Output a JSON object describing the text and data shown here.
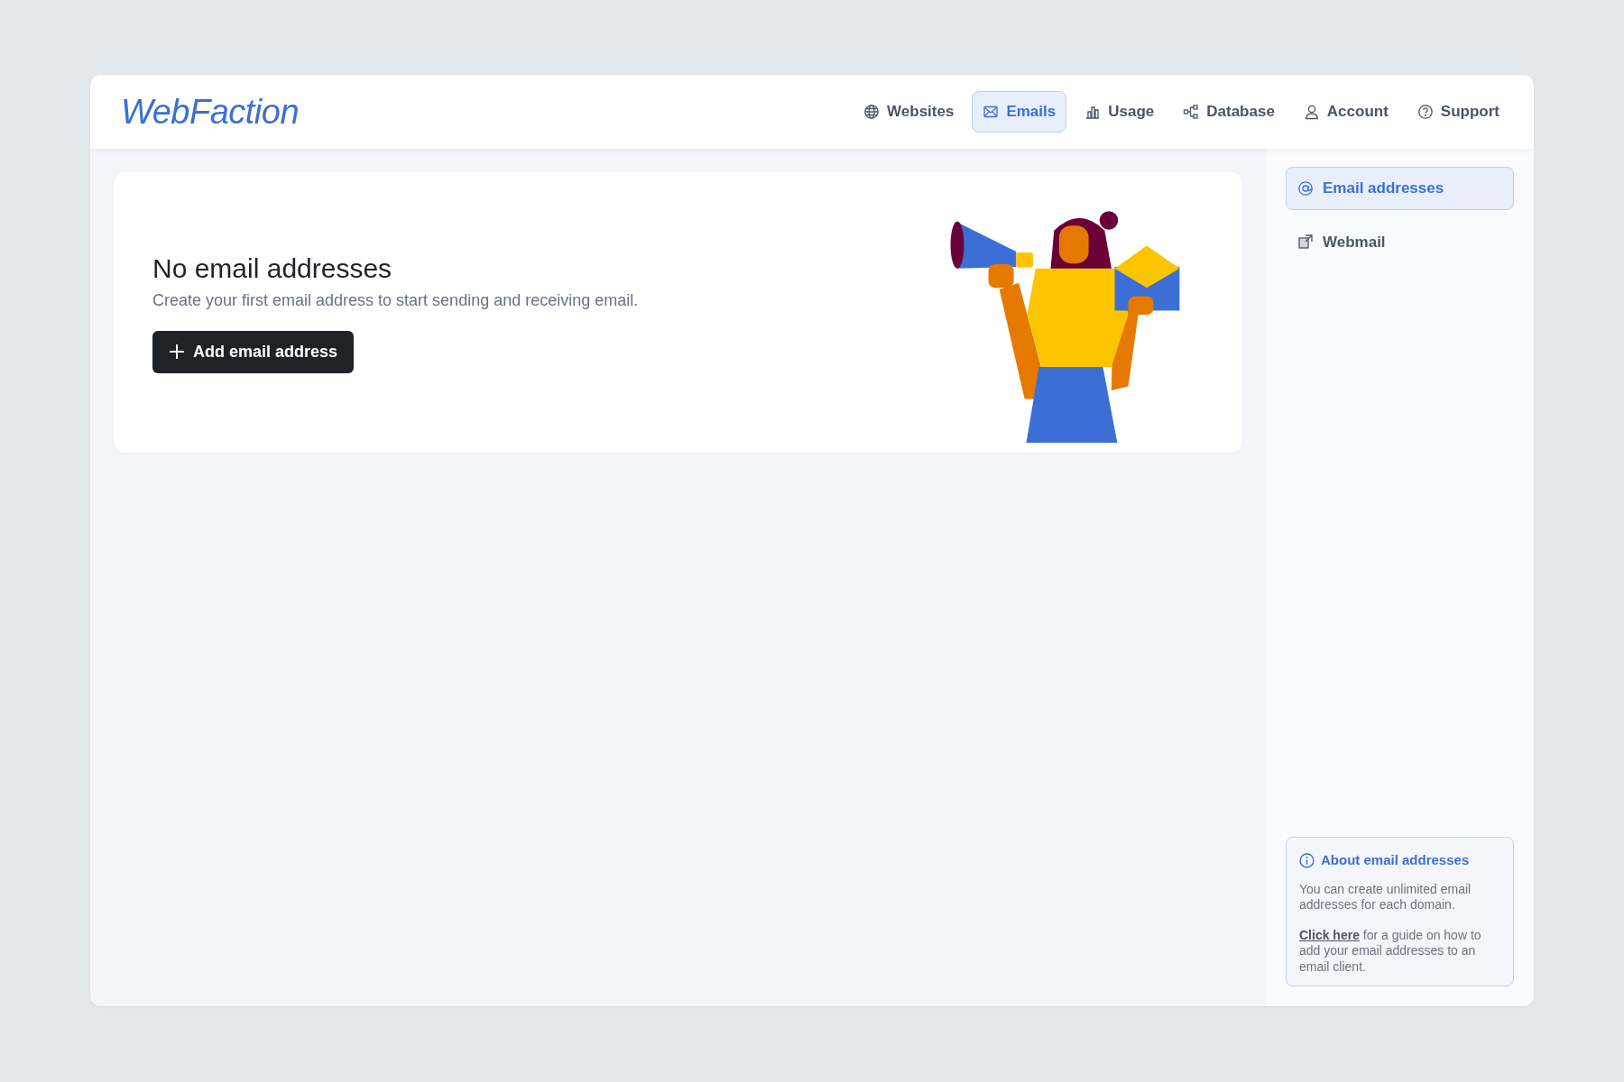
{
  "brand": "WebFaction",
  "nav": [
    {
      "label": "Websites",
      "kind": "globe",
      "selected": false
    },
    {
      "label": "Emails",
      "kind": "mail",
      "selected": true
    },
    {
      "label": "Usage",
      "kind": "chart",
      "selected": false
    },
    {
      "label": "Database",
      "kind": "nodes",
      "selected": false
    },
    {
      "label": "Account",
      "kind": "user",
      "selected": false
    },
    {
      "label": "Support",
      "kind": "help",
      "selected": false
    }
  ],
  "empty_state": {
    "title": "No email addresses",
    "text": "Create your first email address to start sending and receiving email.",
    "button": "Add email address"
  },
  "sidebar": {
    "items": [
      {
        "label": "Email addresses",
        "kind": "at",
        "selected": true
      },
      {
        "label": "Webmail",
        "kind": "external",
        "selected": false
      }
    ],
    "info": {
      "title": "About email addresses",
      "text": "You can create unlimited email addresses for each domain.",
      "link": "Click here",
      "link_text": " for a guide on how to add your email addresses to an email client."
    }
  }
}
